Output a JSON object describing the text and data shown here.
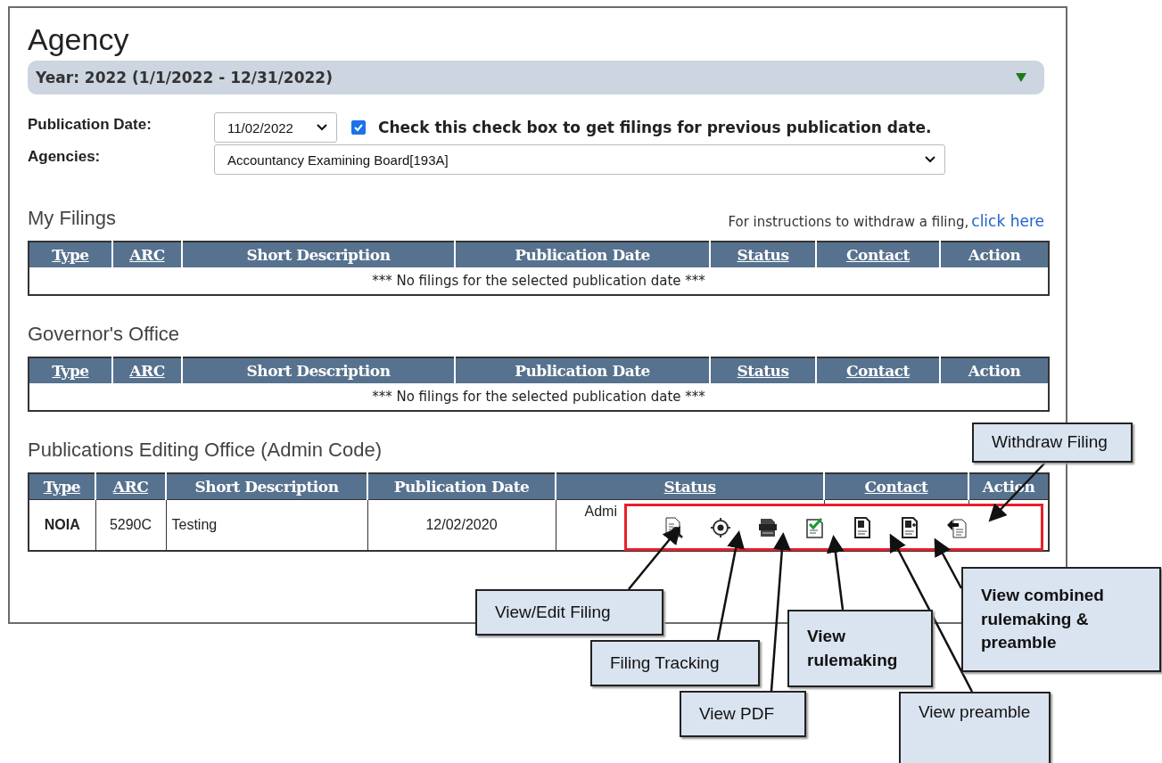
{
  "page": {
    "title": "Agency"
  },
  "year_bar": {
    "label": "Year: 2022 (1/1/2022 - 12/31/2022)",
    "expanded": true
  },
  "filters": {
    "publication_date_label": "Publication Date:",
    "publication_date": "11/02/2022",
    "previous_checkbox": {
      "label": "Check this check box to get filings for previous publication date.",
      "checked": true
    },
    "agencies_label": "Agencies:",
    "agency": "Accountancy Examining Board[193A]"
  },
  "sections": [
    {
      "title": "My Filings",
      "note": "For instructions to withdraw a filing,",
      "link": "click here",
      "columns": [
        {
          "label": "Type",
          "sortable": true
        },
        {
          "label": "ARC",
          "sortable": true
        },
        {
          "label": "Short Description",
          "sortable": false
        },
        {
          "label": "Publication Date",
          "sortable": false
        },
        {
          "label": "Status",
          "sortable": true
        },
        {
          "label": "Contact",
          "sortable": true
        },
        {
          "label": "Action",
          "sortable": false
        }
      ],
      "empty_message": "*** No filings for the selected publication date ***"
    },
    {
      "title": "Governor's Office",
      "columns": [
        {
          "label": "Type",
          "sortable": true
        },
        {
          "label": "ARC",
          "sortable": true
        },
        {
          "label": "Short Description",
          "sortable": false
        },
        {
          "label": "Publication Date",
          "sortable": false
        },
        {
          "label": "Status",
          "sortable": true
        },
        {
          "label": "Contact",
          "sortable": true
        },
        {
          "label": "Action",
          "sortable": false
        }
      ],
      "empty_message": "*** No filings for the selected publication date ***"
    },
    {
      "title": "Publications Editing Office (Admin Code)",
      "columns": [
        {
          "label": "Type",
          "sortable": true
        },
        {
          "label": "ARC",
          "sortable": true
        },
        {
          "label": "Short Description",
          "sortable": false
        },
        {
          "label": "Publication Date",
          "sortable": false
        },
        {
          "label": "Status",
          "sortable": true
        },
        {
          "label": "Contact",
          "sortable": true
        },
        {
          "label": "Action",
          "sortable": false
        }
      ],
      "rows": [
        {
          "type": "NOIA",
          "arc": "5290C",
          "description": "Testing",
          "date": "12/02/2020",
          "status": "Admi"
        }
      ]
    }
  ],
  "action_icons": [
    {
      "kind": "view"
    },
    {
      "kind": "track"
    },
    {
      "kind": "pdf"
    },
    {
      "kind": "rulemaking"
    },
    {
      "kind": "preamble"
    },
    {
      "kind": "combined"
    },
    {
      "kind": "withdraw"
    }
  ],
  "callouts": [
    {
      "text": "Withdraw Filing",
      "bold": false
    },
    {
      "text": "View/Edit Filing",
      "bold": false
    },
    {
      "text": "Filing Tracking",
      "bold": false
    },
    {
      "text": "View PDF",
      "bold": false
    },
    {
      "text": "View rulemaking",
      "bold": true
    },
    {
      "text": "View combined rulemaking & preamble",
      "bold": true
    },
    {
      "text": "View preamble",
      "bold": false
    }
  ]
}
